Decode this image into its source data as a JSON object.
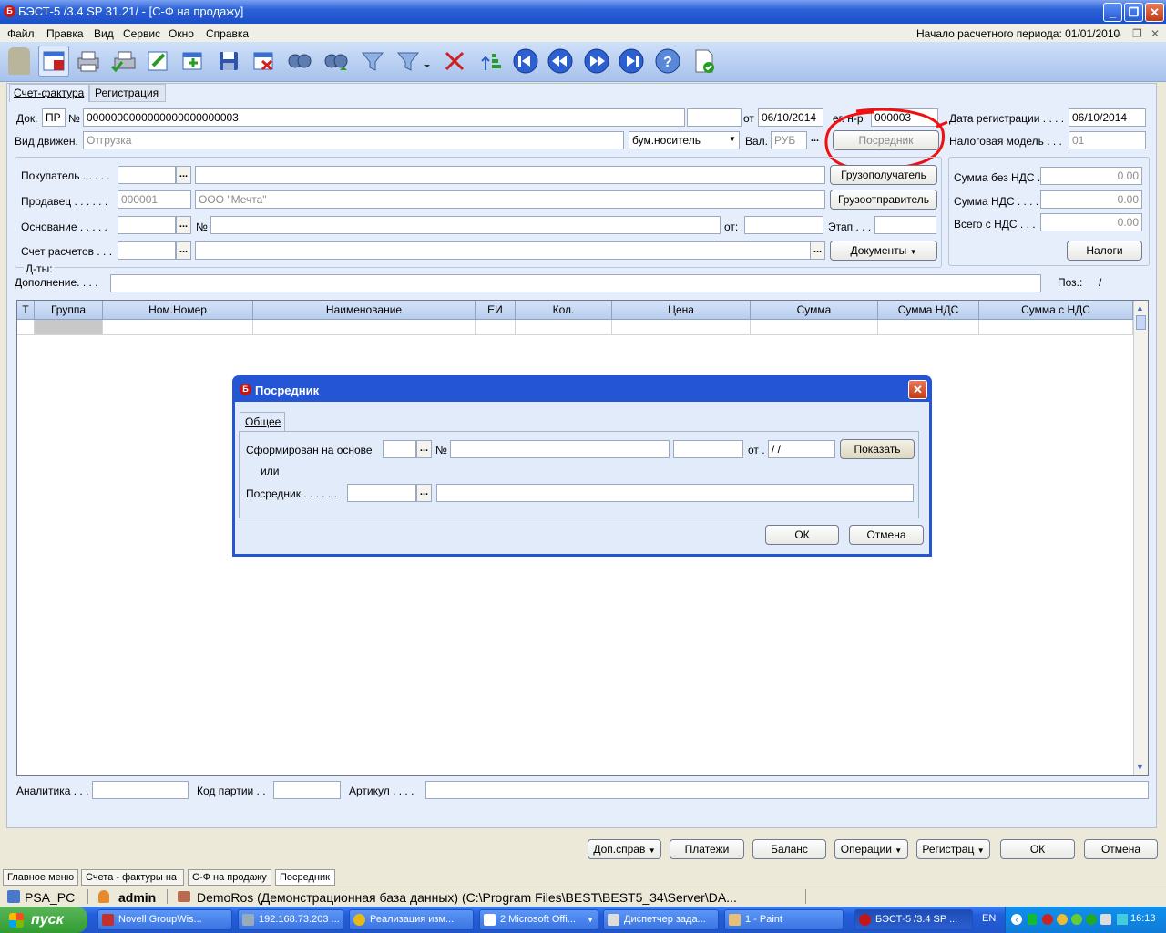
{
  "window": {
    "title": "БЭСТ-5 /3.4 SP 31.21/ - [С-Ф на продажу]",
    "period": "Начало расчетного периода: 01/01/2010"
  },
  "menu": [
    "Файл",
    "Правка",
    "Вид",
    "Сервис",
    "Окно",
    "Справка"
  ],
  "toolbar_icons": [
    "user-icon",
    "invoice-icon",
    "print-icon",
    "print-preview-icon",
    "edit-icon",
    "add-row-icon",
    "save-icon",
    "delete-table-icon",
    "search-icon",
    "search-next-icon",
    "filter-icon",
    "filter-dropdown-icon",
    "clear-filter-icon",
    "sort-icon",
    "first-record-icon",
    "prev-record-icon",
    "next-record-icon",
    "last-record-icon",
    "help-icon",
    "check-document-icon"
  ],
  "tabs": [
    "Счет-фактура",
    "Регистрация"
  ],
  "header": {
    "doc_label": "Док.",
    "doc_type": "ПР",
    "num_label": "№",
    "doc_number": "0000000000000000000000003",
    "from_label": "от",
    "doc_date": "06/10/2014",
    "reg_label": "ег. н-р",
    "reg_number": "000003",
    "reg_date_label": "Дата регистрации . . . .",
    "reg_date": "06/10/2014",
    "move_label": "Вид движен.",
    "move_value": "Отгрузка",
    "carrier": "бум.носитель",
    "cur_label": "Вал.",
    "currency": "РУБ",
    "intermediary_btn": "Посредник",
    "tax_model_label": "Налоговая модель . . .",
    "tax_model": "01"
  },
  "parties": {
    "buyer_label": "Покупатель . . . . .",
    "consignee_btn": "Грузополучатель",
    "seller_label": "Продавец . . . . . .",
    "seller_code": "000001",
    "seller_name": "ООО \"Мечта\"",
    "shipper_btn": "Грузоотправитель",
    "basis_label": "Основание . . . . .",
    "basis_num_label": "№",
    "basis_from_label": "от:",
    "stage_label": "Этап . . .",
    "account_label": "Счет расчетов . . .",
    "documents_btn": "Документы",
    "dates_label": "Д-ты:",
    "addition_label": "Дополнение. . . .",
    "pos_label": "Поз.:",
    "pos_value": "/"
  },
  "totals": {
    "no_vat_label": "Сумма без НДС .",
    "no_vat": "0.00",
    "vat_label": "Сумма НДС . . . .",
    "vat": "0.00",
    "total_label": "Всего с НДС . . .",
    "total": "0.00",
    "taxes_btn": "Налоги"
  },
  "grid": {
    "columns": [
      "Т",
      "Группа",
      "Ном.Номер",
      "Наименование",
      "ЕИ",
      "Кол.",
      "Цена",
      "Сумма",
      "Сумма НДС",
      "Сумма с НДС"
    ]
  },
  "footer": {
    "analytics_label": "Аналитика . . .",
    "batch_label": "Код партии . .",
    "article_label": "Артикул . . . ."
  },
  "buttons": [
    "Доп.справ",
    "Платежи",
    "Баланс",
    "Операции",
    "Регистрац",
    "ОК",
    "Отмена"
  ],
  "dialog": {
    "title": "Посредник",
    "tab": "Общее",
    "basis_label": "Сформирован на основе",
    "num_label": "№",
    "from_label": "от .",
    "date_value": " /  / ",
    "show_btn": "Показать",
    "or_label": "или",
    "intermediary_label": "Посредник . . . . . .",
    "ok": "ОК",
    "cancel": "Отмена"
  },
  "bottom_tabs": [
    "Главное меню",
    "Счета - фактуры на",
    "С-Ф на продажу",
    "Посредник"
  ],
  "status": {
    "pc": "PSA_PC",
    "user": "admin",
    "db": "DemoRos (Демонстрационная база данных) (C:\\Program Files\\BEST\\BEST5_34\\Server\\DA..."
  },
  "taskbar": {
    "start": "пуск",
    "tasks": [
      "Novell GroupWis...",
      "192.168.73.203 ...",
      "Реализация изм...",
      "2 Microsoft Offi...",
      "Диспетчер зада...",
      "1 - Paint",
      "БЭСТ-5 /3.4 SP ..."
    ],
    "lang": "EN",
    "clock": "16:13"
  }
}
